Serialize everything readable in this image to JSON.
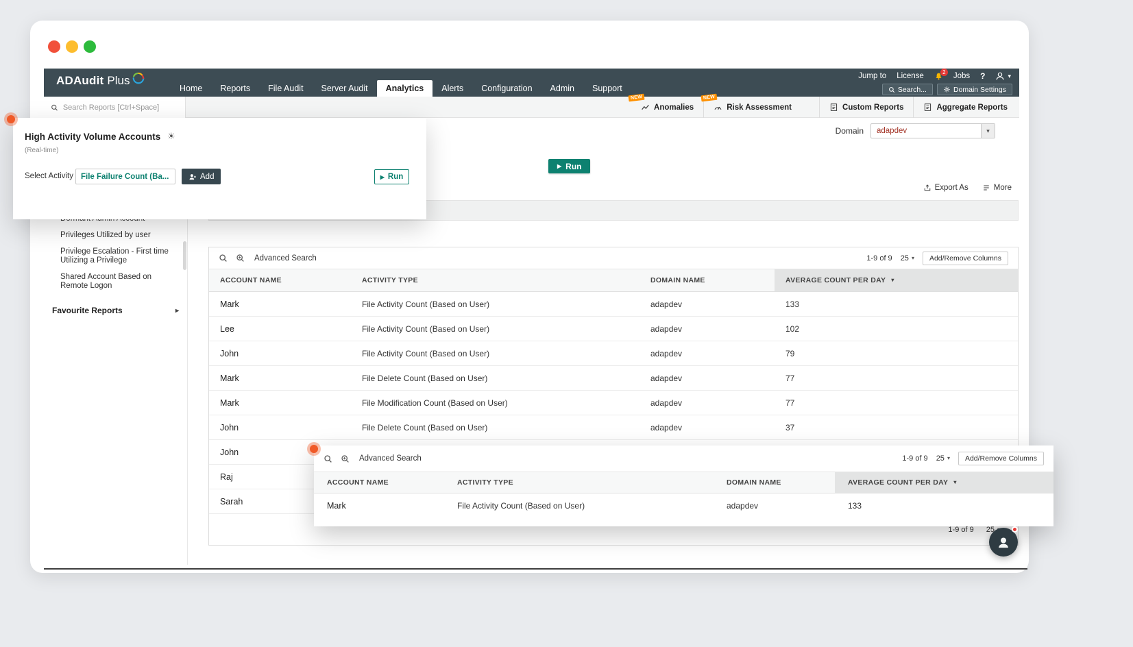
{
  "icons": {
    "caret_down": "▾",
    "play": "▶",
    "sun": "☀",
    "submenu_arrow": "▸"
  },
  "colors": {
    "navbar_dark": "#3d4c54",
    "accent_teal": "#0d8170",
    "badge_orange": "#ff9100",
    "marker_orange": "#f05a28"
  },
  "navbar": {
    "logo_part1": "ADAudit",
    "logo_part2": "Plus",
    "menu": [
      "Home",
      "Reports",
      "File Audit",
      "Server Audit",
      "Analytics",
      "Alerts",
      "Configuration",
      "Admin",
      "Support"
    ],
    "active_menu": "Analytics",
    "jump_to": "Jump to",
    "license": "License",
    "bell_badge": "2",
    "jobs": "Jobs",
    "help": "?",
    "search_button": "Search...",
    "domain_settings_button": "Domain Settings"
  },
  "reports_bar": {
    "search_placeholder": "Search Reports [Ctrl+Space]",
    "tabs": [
      {
        "label": "Anomalies",
        "badge": "NEW"
      },
      {
        "label": "Risk Assessment",
        "badge": "NEW"
      },
      {
        "label": "Custom Reports",
        "badge": ""
      },
      {
        "label": "Aggregate Reports",
        "badge": ""
      }
    ]
  },
  "overlay_report_config": {
    "title": "High Activity Volume Accounts",
    "subtitle": "(Real-time)",
    "select_activity_label": "Select Activity",
    "activity_value": "File Failure Count (Ba...",
    "add_button": "Add",
    "run_button": "Run"
  },
  "content": {
    "domain_label": "Domain",
    "domain_value": "adapdev",
    "run_button": "Run",
    "export_as": "Export As",
    "more": "More"
  },
  "sidebar": {
    "items": [
      "Dormant Admin Account",
      "Privileges Utilized by user",
      "Privilege Escalation - First time Utilizing a Privilege",
      "Shared Account Based on Remote Logon"
    ],
    "favourite_reports": "Favourite Reports"
  },
  "table": {
    "advanced_search": "Advanced Search",
    "pagination": "1-9 of 9",
    "page_size": "25",
    "add_remove_columns": "Add/Remove Columns",
    "headers": [
      "ACCOUNT NAME",
      "ACTIVITY TYPE",
      "DOMAIN NAME",
      "AVERAGE COUNT PER DAY"
    ],
    "rows": [
      {
        "account": "Mark",
        "activity": "File Activity Count (Based on User)",
        "domain": "adapdev",
        "count": "133"
      },
      {
        "account": "Lee",
        "activity": "File Activity Count (Based on User)",
        "domain": "adapdev",
        "count": "102"
      },
      {
        "account": "John",
        "activity": "File Activity Count (Based on User)",
        "domain": "adapdev",
        "count": "79"
      },
      {
        "account": "Mark",
        "activity": "File Delete Count (Based on User)",
        "domain": "adapdev",
        "count": "77"
      },
      {
        "account": "Mark",
        "activity": "File Modification Count (Based on User)",
        "domain": "adapdev",
        "count": "77"
      },
      {
        "account": "John",
        "activity": "File Delete Count (Based on User)",
        "domain": "adapdev",
        "count": "37"
      },
      {
        "account": "John",
        "activity": "",
        "domain": "",
        "count": ""
      },
      {
        "account": "Raj",
        "activity": "",
        "domain": "",
        "count": ""
      },
      {
        "account": "Sarah",
        "activity": "",
        "domain": "",
        "count": ""
      }
    ],
    "footer_pagination": "1-9 of 9",
    "footer_page_size": "25"
  },
  "overlay_table": {
    "advanced_search": "Advanced Search",
    "pagination": "1-9 of 9",
    "page_size": "25",
    "add_remove_columns": "Add/Remove Columns",
    "headers": [
      "ACCOUNT NAME",
      "ACTIVITY TYPE",
      "DOMAIN NAME",
      "AVERAGE COUNT PER DAY"
    ],
    "row": {
      "account": "Mark",
      "activity": "File Activity Count (Based on User)",
      "domain": "adapdev",
      "count": "133"
    }
  }
}
